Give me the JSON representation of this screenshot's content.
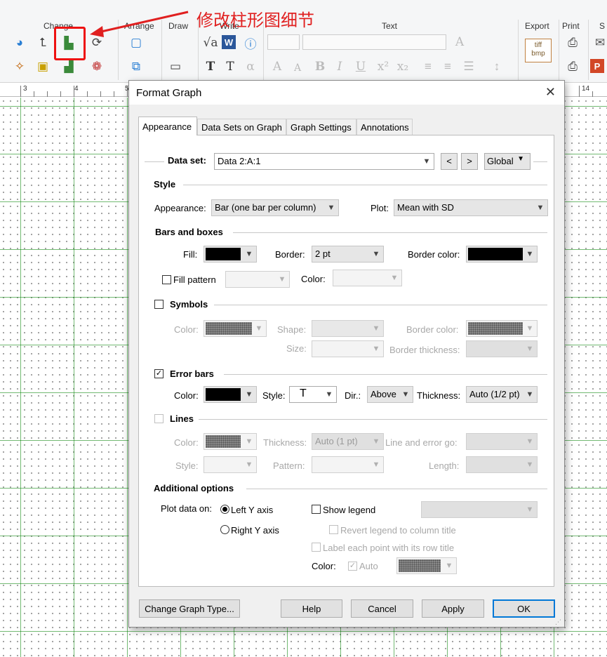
{
  "annotation": {
    "text": "修改柱形图细节",
    "color": "#e02020"
  },
  "ribbon": {
    "groups": {
      "change": "Change",
      "arrange": "Arrange",
      "draw": "Draw",
      "write": "Write",
      "text": "Text",
      "export": "Export",
      "print": "Print",
      "send": "S"
    },
    "export_icon_text": [
      "tiff",
      "bmp"
    ]
  },
  "ruler": {
    "labels": [
      "3",
      "4",
      "5",
      "14"
    ]
  },
  "dialog": {
    "title": "Format Graph",
    "close_glyph": "✕",
    "tabs": [
      {
        "label": "Appearance",
        "active": true
      },
      {
        "label": "Data Sets on Graph",
        "active": false
      },
      {
        "label": "Graph Settings",
        "active": false
      },
      {
        "label": "Annotations",
        "active": false
      }
    ],
    "dataset": {
      "label": "Data set:",
      "value": "Data 2:A:1",
      "prev": "<",
      "next": ">",
      "global": "Global"
    },
    "style": {
      "header": "Style",
      "appearance_label": "Appearance:",
      "appearance_value": "Bar (one bar per column)",
      "plot_label": "Plot:",
      "plot_value": "Mean with SD"
    },
    "bars": {
      "header": "Bars and boxes",
      "fill_label": "Fill:",
      "fill_color": "#000000",
      "border_label": "Border:",
      "border_value": "2 pt",
      "border_color_label": "Border color:",
      "border_color": "#000000",
      "fill_pattern_label": "Fill pattern",
      "fill_pattern_checked": false,
      "pattern_color_label": "Color:"
    },
    "symbols": {
      "header": "Symbols",
      "checked": false,
      "color_label": "Color:",
      "shape_label": "Shape:",
      "border_color_label": "Border color:",
      "size_label": "Size:",
      "border_thickness_label": "Border thickness:"
    },
    "error_bars": {
      "header": "Error bars",
      "checked": true,
      "color_label": "Color:",
      "color": "#000000",
      "style_label": "Style:",
      "style_glyph": "T",
      "dir_label": "Dir.:",
      "dir_value": "Above",
      "thickness_label": "Thickness:",
      "thickness_value": "Auto (1/2 pt)"
    },
    "lines": {
      "header": "Lines",
      "checked": false,
      "color_label": "Color:",
      "thickness_label": "Thickness:",
      "thickness_value": "Auto (1 pt)",
      "line_error_label": "Line and error go:",
      "style_label": "Style:",
      "pattern_label": "Pattern:",
      "length_label": "Length:"
    },
    "additional": {
      "header": "Additional options",
      "plot_on_label": "Plot data on:",
      "left_axis": "Left Y axis",
      "right_axis": "Right  Y axis",
      "axis_selected": "left",
      "show_legend": "Show legend",
      "show_legend_checked": false,
      "revert_legend": "Revert legend to column title",
      "label_each_point": "Label each point with its row title",
      "color_label": "Color:",
      "auto_label": "Auto",
      "auto_checked": true
    },
    "buttons": {
      "change_type": "Change Graph Type...",
      "help": "Help",
      "cancel": "Cancel",
      "apply": "Apply",
      "ok": "OK"
    }
  }
}
